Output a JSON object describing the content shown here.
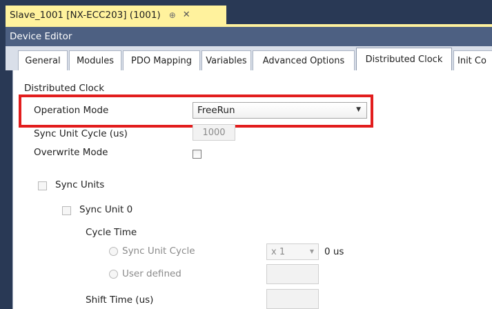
{
  "document_tab": {
    "title": "Slave_1001 [NX-ECC203] (1001)",
    "pin_glyph": "⊕",
    "close_glyph": "✕"
  },
  "editor": {
    "header": "Device Editor"
  },
  "tabs": [
    {
      "label": "General"
    },
    {
      "label": "Modules"
    },
    {
      "label": "PDO Mapping"
    },
    {
      "label": "Variables"
    },
    {
      "label": "Advanced Options"
    },
    {
      "label": "Distributed Clock"
    },
    {
      "label": "Init Co"
    }
  ],
  "active_tab": "Distributed Clock",
  "distributed_clock": {
    "group_label": "Distributed Clock",
    "operation_mode": {
      "label": "Operation Mode",
      "value": "FreeRun"
    },
    "sync_unit_cycle": {
      "label": "Sync Unit Cycle (us)",
      "value": "1000"
    },
    "overwrite_mode": {
      "label": "Overwrite Mode",
      "checked": false
    }
  },
  "sync_units": {
    "label": "Sync Units",
    "unit0": {
      "label": "Sync Unit 0",
      "cycle_time": {
        "label": "Cycle Time",
        "option_sync_unit_cycle": "Sync Unit Cycle",
        "multiplier": "x 1",
        "result": "0 us",
        "option_user_defined": "User defined"
      },
      "shift_time": {
        "label": "Shift Time (us)"
      }
    }
  },
  "colors": {
    "frame": "#293955",
    "document_tab": "#fff29d",
    "editor_header": "#4d6082",
    "tab_bar": "#d9dfe9",
    "highlight": "#e21d1d"
  },
  "icons": {
    "dropdown": "chevron-down-icon",
    "pin": "pin-icon",
    "close": "close-icon"
  }
}
